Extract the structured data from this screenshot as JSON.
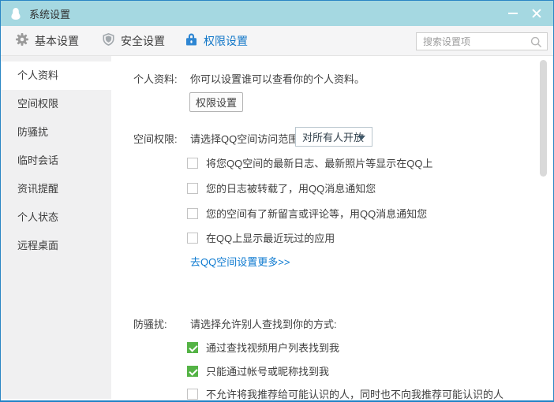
{
  "window": {
    "title": "系统设置",
    "controls": {
      "minimize": "minimize-window",
      "close": "close-window"
    }
  },
  "tabbar": {
    "tabs": [
      {
        "label": "基本设置",
        "icon": "gear-icon",
        "active": false
      },
      {
        "label": "安全设置",
        "icon": "shield-icon",
        "active": false
      },
      {
        "label": "权限设置",
        "icon": "lock-icon",
        "active": true
      }
    ],
    "search": {
      "placeholder": "搜索设置项",
      "value": "",
      "icon": "magnifier-icon"
    }
  },
  "sidebar": {
    "items": [
      {
        "label": "个人资料",
        "active": true
      },
      {
        "label": "空间权限",
        "active": false
      },
      {
        "label": "防骚扰",
        "active": false
      },
      {
        "label": "临时会话",
        "active": false
      },
      {
        "label": "资讯提醒",
        "active": false
      },
      {
        "label": "个人状态",
        "active": false
      },
      {
        "label": "远程桌面",
        "active": false
      }
    ]
  },
  "content": {
    "profile": {
      "label": "个人资料:",
      "description": "你可以设置谁可以查看你的个人资料。",
      "button_label": "权限设置"
    },
    "qzone": {
      "label": "空间权限:",
      "prompt": "请选择QQ空间访问范围：",
      "dropdown_value": "对所有人开放",
      "checkboxes": [
        {
          "label": "将您QQ空间的最新日志、最新照片等显示在QQ上",
          "checked": false
        },
        {
          "label": "您的日志被转载了，用QQ消息通知您",
          "checked": false
        },
        {
          "label": "您的空间有了新留言或评论等，用QQ消息通知您",
          "checked": false
        },
        {
          "label": "在QQ上显示最近玩过的应用",
          "checked": false
        }
      ],
      "link": "去QQ空间设置更多>>"
    },
    "antiharass": {
      "label": "防骚扰:",
      "prompt": "请选择允许别人查找到你的方式:",
      "checkboxes": [
        {
          "label": "通过查找视频用户列表找到我",
          "checked": true
        },
        {
          "label": "只能通过帐号或昵称找到我",
          "checked": true
        },
        {
          "label": "不允许将我推荐给可能认识的人，同时也不向我推荐可能认识的人",
          "checked": false
        }
      ]
    }
  },
  "colors": {
    "titlebar_teal": "#a5d8e1",
    "accent_blue": "#1277c8",
    "lock_blue": "#2e86d3",
    "checkbox_green": "#54b345",
    "link_blue": "#0d7ad0",
    "window_border": "#1f82c6"
  }
}
